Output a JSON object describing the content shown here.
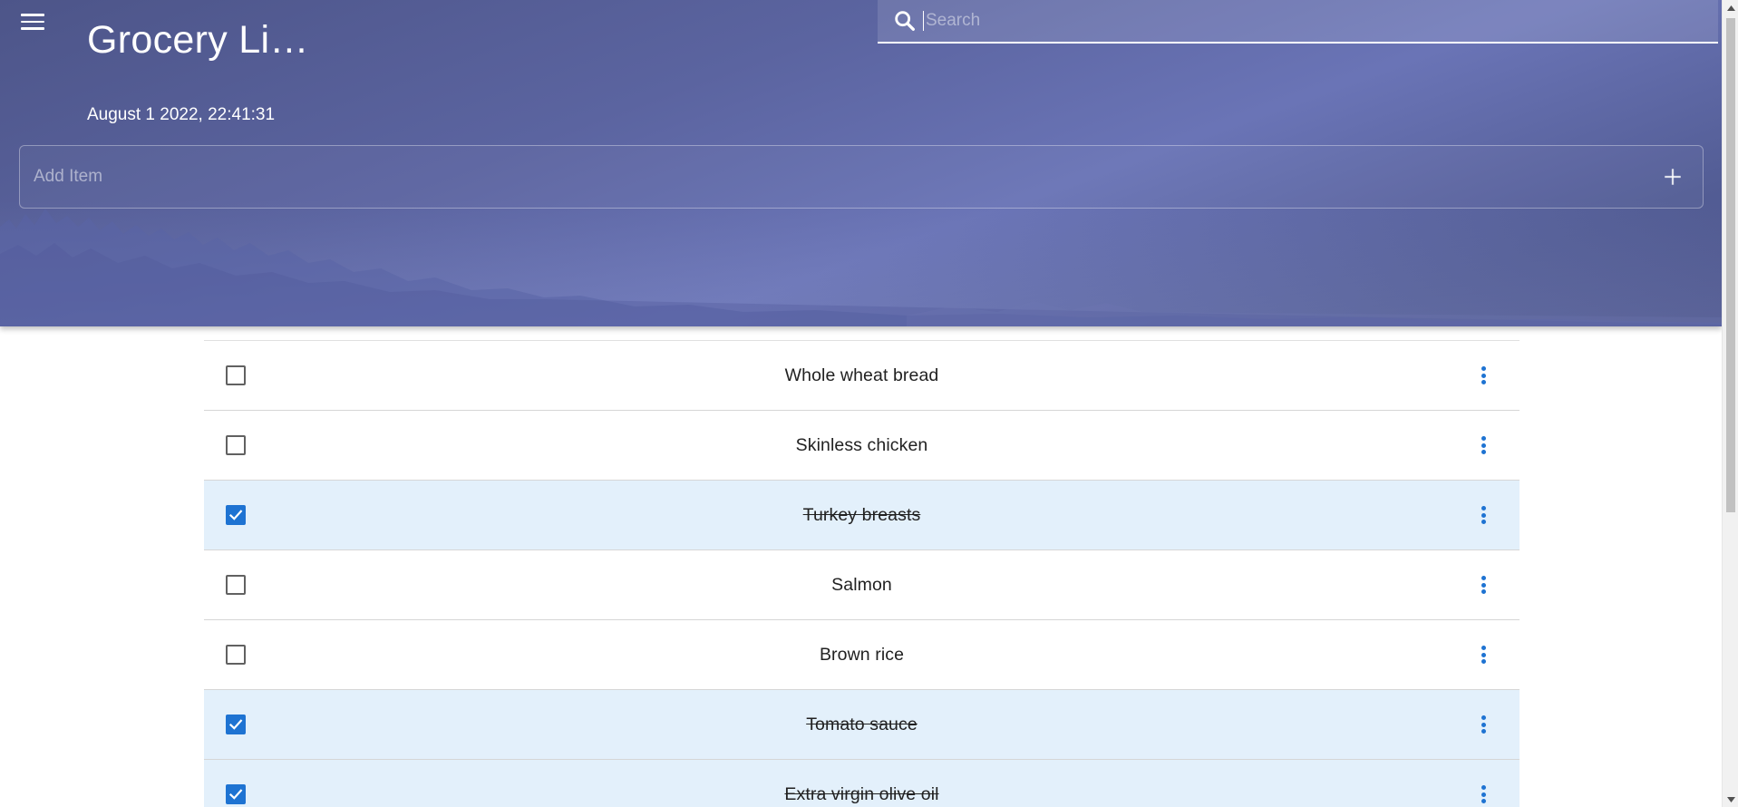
{
  "header": {
    "title": "Grocery Li…",
    "date": "August 1 2022, 22:41:31"
  },
  "search": {
    "placeholder": "Search",
    "value": ""
  },
  "add_item": {
    "placeholder": "Add Item",
    "value": ""
  },
  "list": {
    "items": [
      {
        "label": "Whole wheat bread",
        "checked": false
      },
      {
        "label": "Skinless chicken",
        "checked": false
      },
      {
        "label": "Turkey breasts",
        "checked": true
      },
      {
        "label": "Salmon",
        "checked": false
      },
      {
        "label": "Brown rice",
        "checked": false
      },
      {
        "label": "Tomato sauce",
        "checked": true
      },
      {
        "label": "Extra virgin olive oil",
        "checked": true
      }
    ]
  },
  "icons": {
    "menu": "hamburger-menu-icon",
    "search": "search-icon",
    "add": "plus-icon",
    "more": "more-vertical-icon",
    "check": "check-icon"
  },
  "colors": {
    "header_top": "#4d5589",
    "header_mid": "#6a74b6",
    "accent": "#1e73d2",
    "checked_row": "#e3f0fb",
    "text": "#212121"
  }
}
